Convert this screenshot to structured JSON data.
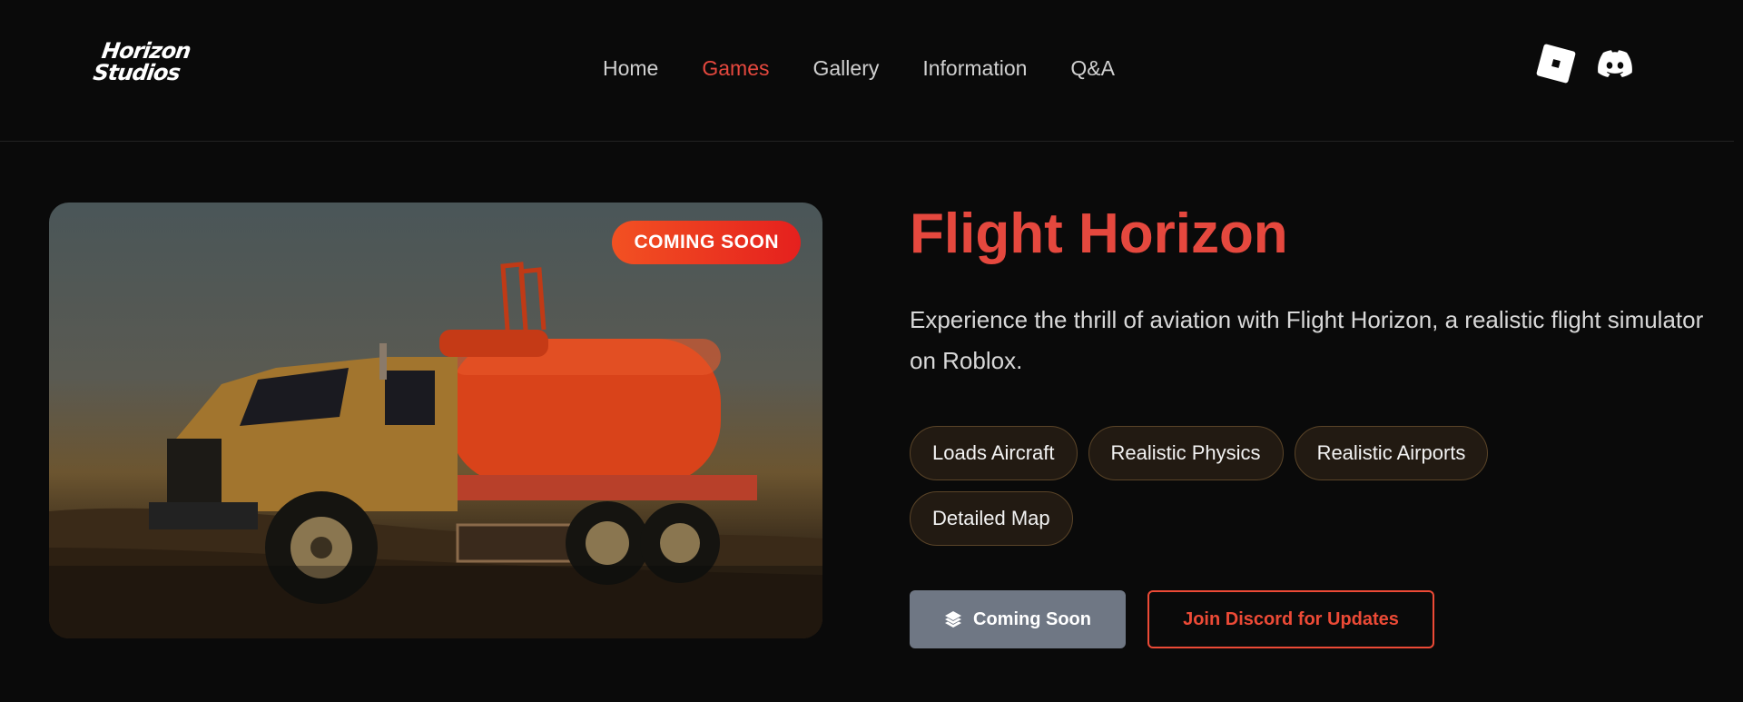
{
  "logo": {
    "line1": "Horizon",
    "line2": "Studios"
  },
  "nav": {
    "items": [
      {
        "label": "Home"
      },
      {
        "label": "Games"
      },
      {
        "label": "Gallery"
      },
      {
        "label": "Information"
      },
      {
        "label": "Q&A"
      }
    ],
    "active": "Games"
  },
  "socials": {
    "icons": [
      "roblox-icon",
      "discord-icon"
    ]
  },
  "hero": {
    "badge": "COMING SOON",
    "image_subject": "orange tanker truck in desert at sunset"
  },
  "game": {
    "title": "Flight Horizon",
    "description": "Experience the thrill of aviation with Flight Horizon, a realistic flight simulator on Roblox.",
    "tags": [
      "Loads Aircraft",
      "Realistic Physics",
      "Realistic Airports",
      "Detailed Map"
    ]
  },
  "actions": {
    "primary_label": "Coming Soon",
    "primary_icon": "layers-icon",
    "secondary_label": "Join Discord for Updates"
  },
  "colors": {
    "background": "#0a0a0a",
    "accent": "#e5483e",
    "badge": "#ef3a20",
    "primary_button": "#6f7784"
  }
}
